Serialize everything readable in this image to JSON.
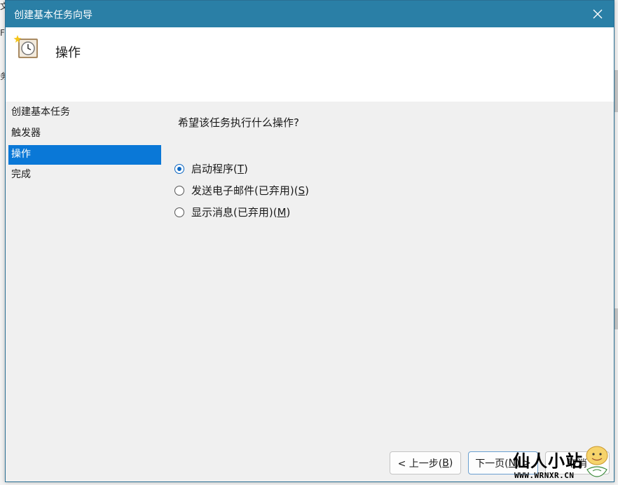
{
  "dialog": {
    "title": "创建基本任务向导",
    "header_title": "操作"
  },
  "nav": {
    "items": [
      {
        "label": "创建基本任务"
      },
      {
        "label": "触发器"
      },
      {
        "label": "操作"
      },
      {
        "label": "完成"
      }
    ],
    "active_index": 2
  },
  "main": {
    "question": "希望该任务执行什么操作?",
    "options": [
      {
        "text": "启动程序(",
        "key": "T",
        "end": ")",
        "checked": true
      },
      {
        "text": "发送电子邮件(已弃用)(",
        "key": "S",
        "end": ")",
        "checked": false
      },
      {
        "text": "显示消息(已弃用)(",
        "key": "M",
        "end": ")",
        "checked": false
      }
    ]
  },
  "buttons": {
    "back_prefix": "< 上一步(",
    "back_key": "B",
    "back_suffix": ")",
    "next_prefix": "下一页(",
    "next_key": "N",
    "next_suffix": ") >",
    "cancel": "取消"
  },
  "watermark": {
    "text": "仙人小站",
    "url": "WWW.WRNXR.CN"
  },
  "background": {
    "fragments": [
      "文",
      "F",
      "务"
    ]
  },
  "colors": {
    "titlebar": "#2a7fa6",
    "selection": "#0a78d7",
    "radio_accent": "#0a66c2"
  },
  "icons": {
    "header": "scheduled-task-clock-icon",
    "close": "close-icon"
  }
}
